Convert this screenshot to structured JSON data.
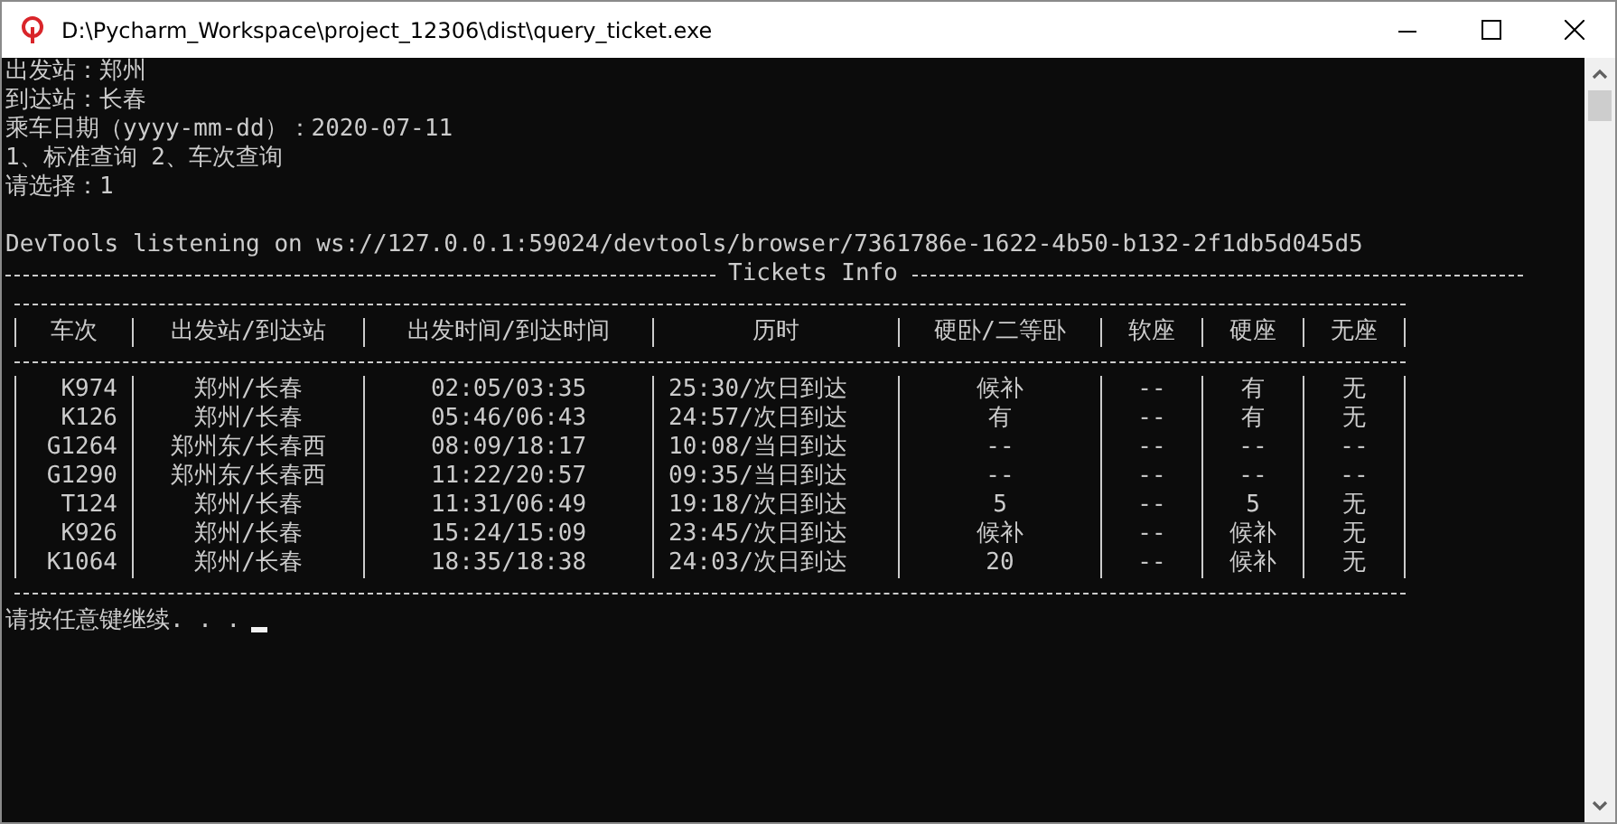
{
  "window": {
    "title": "D:\\Pycharm_Workspace\\project_12306\\dist\\query_ticket.exe"
  },
  "console": {
    "lines": [
      "出发站：郑州",
      "到达站：长春",
      "乘车日期（yyyy-mm-dd）：2020-07-11",
      "1、标准查询 2、车次查询",
      "请选择：1"
    ],
    "log_line": "DevTools listening on ws://127.0.0.1:59024/devtools/browser/7361786e-1622-4b50-b132-2f1db5d045d5",
    "table_title": "Tickets Info",
    "table": {
      "columns": [
        "车次",
        "出发站/到达站",
        "出发时间/到达时间",
        "历时",
        "硬卧/二等卧",
        "软座",
        "硬座",
        "无座"
      ],
      "rows": [
        [
          "K974",
          "郑州/长春",
          "02:05/03:35",
          "25:30/次日到达",
          "候补",
          "--",
          "有",
          "无"
        ],
        [
          "K126",
          "郑州/长春",
          "05:46/06:43",
          "24:57/次日到达",
          "有",
          "--",
          "有",
          "无"
        ],
        [
          "G1264",
          "郑州东/长春西",
          "08:09/18:17",
          "10:08/当日到达",
          "--",
          "--",
          "--",
          "--"
        ],
        [
          "G1290",
          "郑州东/长春西",
          "11:22/20:57",
          "09:35/当日到达",
          "--",
          "--",
          "--",
          "--"
        ],
        [
          "T124",
          "郑州/长春",
          "11:31/06:49",
          "19:18/次日到达",
          "5",
          "--",
          "5",
          "无"
        ],
        [
          "K926",
          "郑州/长春",
          "15:24/15:09",
          "23:45/次日到达",
          "候补",
          "--",
          "候补",
          "无"
        ],
        [
          "K1064",
          "郑州/长春",
          "18:35/18:38",
          "24:03/次日到达",
          "20",
          "--",
          "候补",
          "无"
        ]
      ]
    },
    "prompt": "请按任意键继续. . ."
  }
}
